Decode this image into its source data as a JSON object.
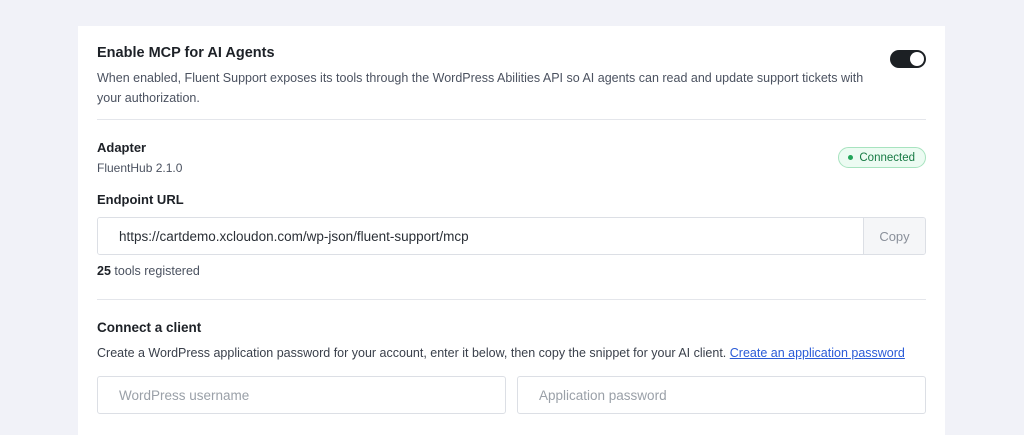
{
  "mcp": {
    "title": "Enable MCP for AI Agents",
    "description": "When enabled, Fluent Support exposes its tools through the WordPress Abilities API so AI agents can read and update support tickets with your authorization.",
    "enabled": true
  },
  "adapter": {
    "label": "Adapter",
    "version": "FluentHub 2.1.0",
    "status": "Connected",
    "status_color": "#22a559"
  },
  "endpoint": {
    "label": "Endpoint URL",
    "url": "https://cartdemo.xcloudon.com/wp-json/fluent-support/mcp",
    "copy_label": "Copy",
    "tools_count": "25",
    "tools_suffix": "tools registered"
  },
  "client": {
    "title": "Connect a client",
    "description": "Create a WordPress application password for your account, enter it below, then copy the snippet for your AI client.",
    "link_text": "Create an application password",
    "username_placeholder": "WordPress username",
    "password_placeholder": "Application password"
  },
  "colors": {
    "toggle_on": "#1c2024",
    "link": "#2a5bd7",
    "badge_text": "#177a44"
  }
}
